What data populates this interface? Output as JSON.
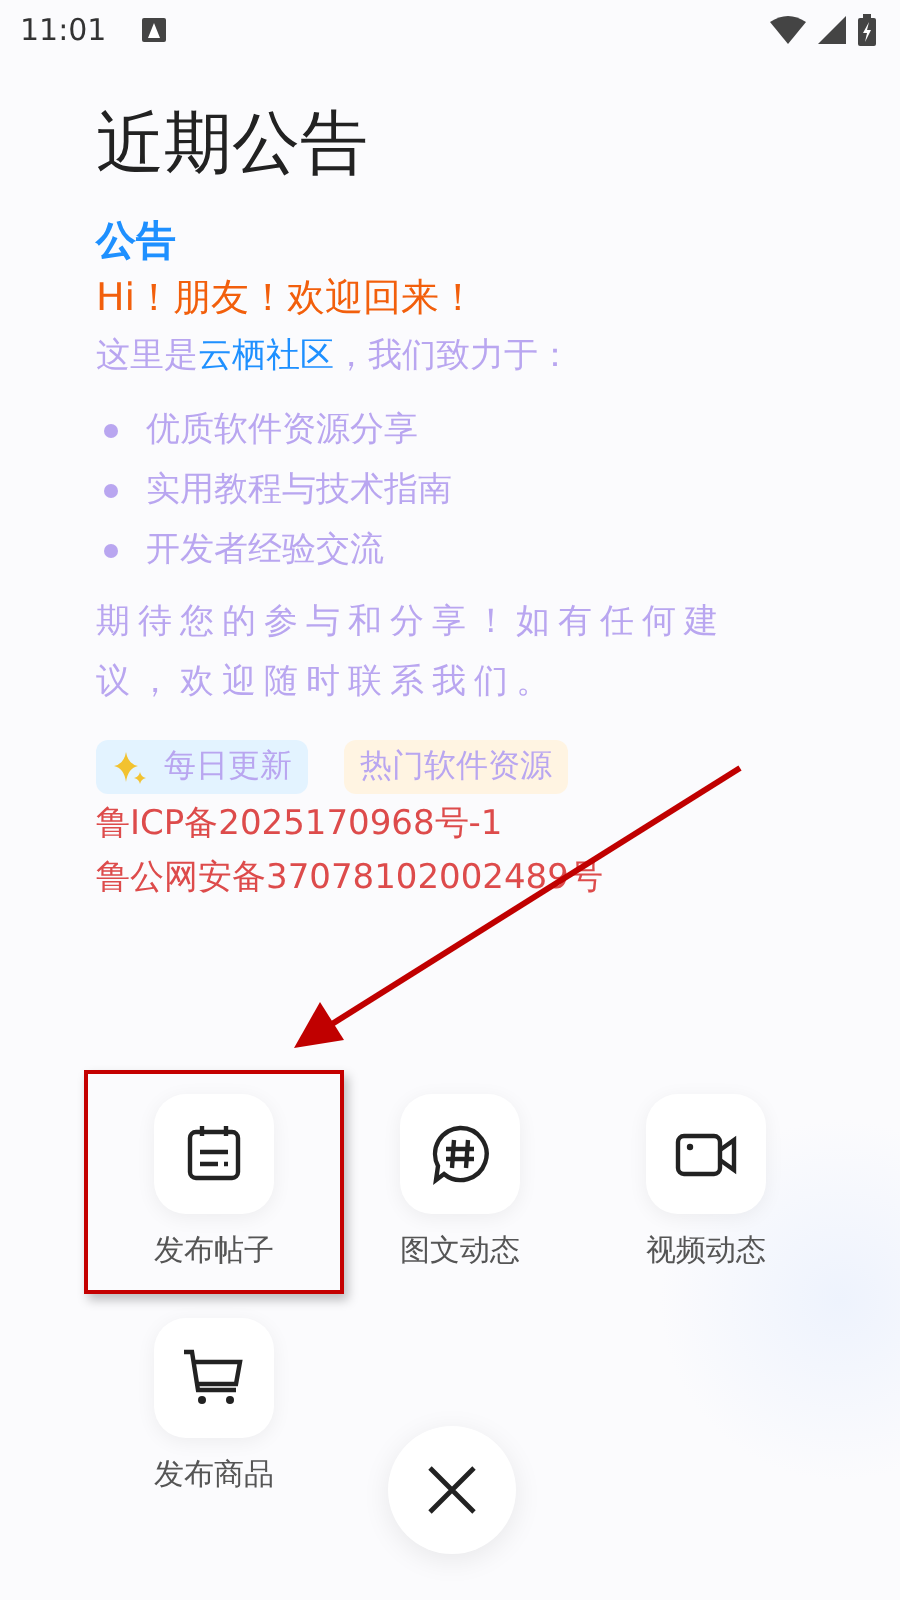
{
  "status_bar": {
    "time": "11:01"
  },
  "page": {
    "title": "近期公告"
  },
  "notice": {
    "heading": "公告",
    "greeting": "Hi！朋友！欢迎回来！",
    "intro": [
      {
        "kind": "plain",
        "text": "这里是"
      },
      {
        "kind": "link",
        "text": "云栖社区"
      },
      {
        "kind": "plain",
        "text": "，我们致力于："
      }
    ],
    "bullets": [
      "优质软件资源分享",
      "实用教程与技术指南",
      "开发者经验交流"
    ],
    "closing": "期待您的参与和分享！如有任何建议，欢迎随时联系我们。",
    "tags": [
      {
        "label": "每日更新",
        "color": "#e3f3ff",
        "kind": "sparkle"
      },
      {
        "label": "热门软件资源",
        "color": "#fff4e2",
        "kind": "plain"
      }
    ],
    "licenses": [
      "鲁ICP备2025170968号-1",
      "鲁公网安备37078102002489号"
    ]
  },
  "actions": [
    {
      "label": "发布帖子",
      "kind": "post",
      "highlighted": true
    },
    {
      "label": "图文动态",
      "kind": "topic",
      "highlighted": false
    },
    {
      "label": "视频动态",
      "kind": "video",
      "highlighted": false
    },
    {
      "label": "发布商品",
      "kind": "cart",
      "highlighted": false
    }
  ]
}
